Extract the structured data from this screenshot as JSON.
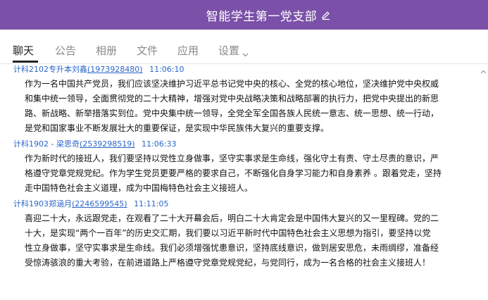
{
  "window": {
    "title": "智能学生第一党支部",
    "accent_color": "#7b50a8"
  },
  "tabs": [
    {
      "label": "聊天",
      "active": true
    },
    {
      "label": "公告",
      "active": false
    },
    {
      "label": "相册",
      "active": false
    },
    {
      "label": "文件",
      "active": false
    },
    {
      "label": "应用",
      "active": false
    },
    {
      "label": "设置",
      "active": false
    }
  ],
  "messages": [
    {
      "sender_name": "计科2102专升本刘鑫",
      "sender_qq": "(1973928480)",
      "time": "11:06:10",
      "lines": [
        "作为一名中国共产党员，我们应该坚决维护习近平总书记党中央的核心、全党的核心地位，坚决维护党中央权威",
        "和集中统一领导，全面贯彻党的二十大精神，增强对党中央战略决策和战略部署的执行力，把党中央提出的新思",
        "路、新战略、新举措落实到位。党中央集中统一领导，全党全军全国各族人民统一意志、统一思想、统一行动，",
        "是党和国家事业不断发展壮大的重要保证，是实现中华民族伟大复兴的重要支撑。"
      ]
    },
    {
      "sender_name": "计科1902 - 梁思奇",
      "sender_qq": "(2539298519)",
      "time": "11:06:33",
      "lines": [
        "作为新时代的接班人，我们要坚持以党性立身做事，坚守实事求是生命线，强化守土有责、守土尽责的意识，严",
        "格遵守党章党规党纪。作为学生党员更要严格的要求自己，不断强化自身学习能力和自身素养 。跟着党走，坚持",
        "走中国特色社会主义道理，成为中国梅特色社会主义接班人。"
      ]
    },
    {
      "sender_name": "计科1903郑涵月",
      "sender_qq": "(2246599545)",
      "time": "11:11:05",
      "lines": [
        "喜迎二十大，永远跟党走，在观看了二十大开幕会后，明白二十大肯定会是中国伟大复兴的又一里程碑。党的二",
        "十大，是实现“两个一百年”的历史交汇期，我们要以习近平新时代中国特色社会主义思想为指引，要坚持以党",
        "性立身做事，坚守实事求是生命线。我们必须增强忧患意识，坚持底线意识，做到居安思危，未雨绸缪，准备经",
        "受惊涛骇浪的重大考验，在前进道路上严格遵守党章党规党纪，与党同行，成为一名合格的社会主义接班人！"
      ]
    }
  ]
}
